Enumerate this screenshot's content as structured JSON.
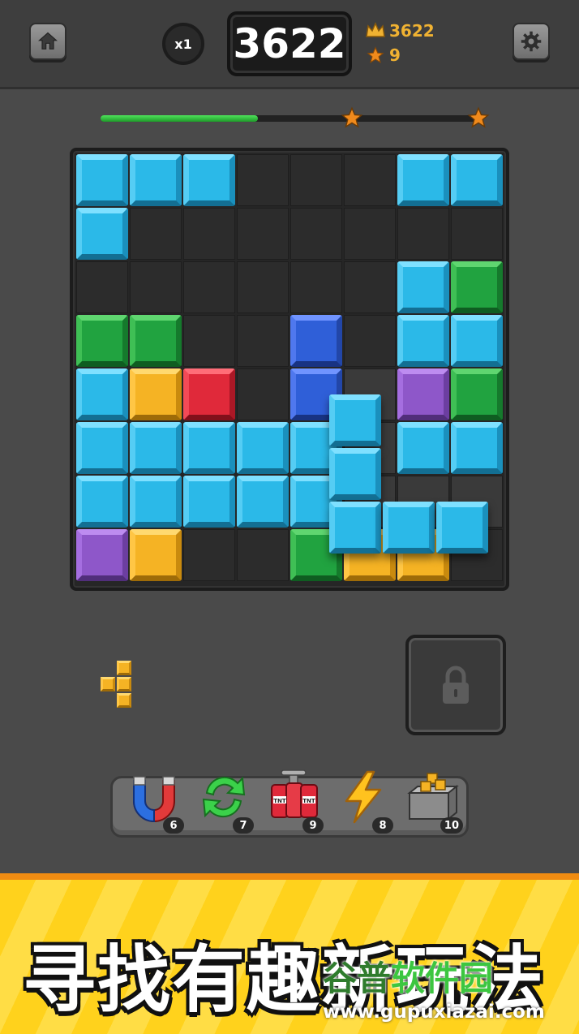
{
  "header": {
    "home_icon": "home-icon",
    "multiplier": "x1",
    "score": "3622",
    "best_score": "3622",
    "stars": "9",
    "settings_icon": "gear-icon"
  },
  "progress": {
    "fill_fraction": 0.41,
    "milestones": [
      "star-icon",
      "star-icon"
    ]
  },
  "board": {
    "rows": 8,
    "cols": 8,
    "grid": [
      [
        "cyan",
        "cyan",
        "cyan",
        "",
        "",
        "",
        "cyan",
        "cyan"
      ],
      [
        "cyan",
        "",
        "",
        "",
        "",
        "",
        "",
        ""
      ],
      [
        "",
        "",
        "",
        "",
        "",
        "",
        "cyan",
        "green"
      ],
      [
        "green",
        "green",
        "",
        "",
        "blue",
        "",
        "cyan",
        "cyan"
      ],
      [
        "cyan",
        "yellow",
        "red",
        "",
        "blue",
        "",
        "purple",
        "green"
      ],
      [
        "cyan",
        "cyan",
        "cyan",
        "cyan",
        "cyan",
        "",
        "cyan",
        "cyan"
      ],
      [
        "cyan",
        "cyan",
        "cyan",
        "cyan",
        "cyan",
        "",
        "",
        ""
      ],
      [
        "purple",
        "yellow",
        "",
        "",
        "green",
        "yellow",
        "yellow",
        ""
      ]
    ],
    "highlighted_cells": [
      [
        4,
        5
      ],
      [
        5,
        5
      ],
      [
        6,
        5
      ],
      [
        6,
        6
      ],
      [
        6,
        7
      ]
    ],
    "dragging_piece": {
      "color": "cyan",
      "cells": [
        [
          0,
          0
        ],
        [
          1,
          0
        ],
        [
          2,
          0
        ],
        [
          2,
          1
        ],
        [
          2,
          2
        ]
      ]
    }
  },
  "tray": {
    "next_piece_color": "yellow",
    "lock_icon": "lock-icon"
  },
  "powerups": [
    {
      "name": "magnet",
      "icon": "magnet-icon",
      "count": "6"
    },
    {
      "name": "refresh",
      "icon": "refresh-icon",
      "count": "7"
    },
    {
      "name": "tnt",
      "icon": "tnt-icon",
      "count": "9"
    },
    {
      "name": "lightning",
      "icon": "lightning-icon",
      "count": "8"
    },
    {
      "name": "block-box",
      "icon": "block-box-icon",
      "count": "10"
    }
  ],
  "banner": {
    "text": "寻找有趣新玩法"
  },
  "watermark": {
    "brand_a": "谷普",
    "brand_b": "软件园",
    "url": "www.gupuxiazai.com"
  },
  "colors": {
    "cyan": "#2bb9e8",
    "green": "#21a340",
    "blue": "#2f5fd8",
    "yellow": "#f5b324",
    "red": "#e0293a",
    "purple": "#8e57c9",
    "accent": "#f0b232"
  }
}
